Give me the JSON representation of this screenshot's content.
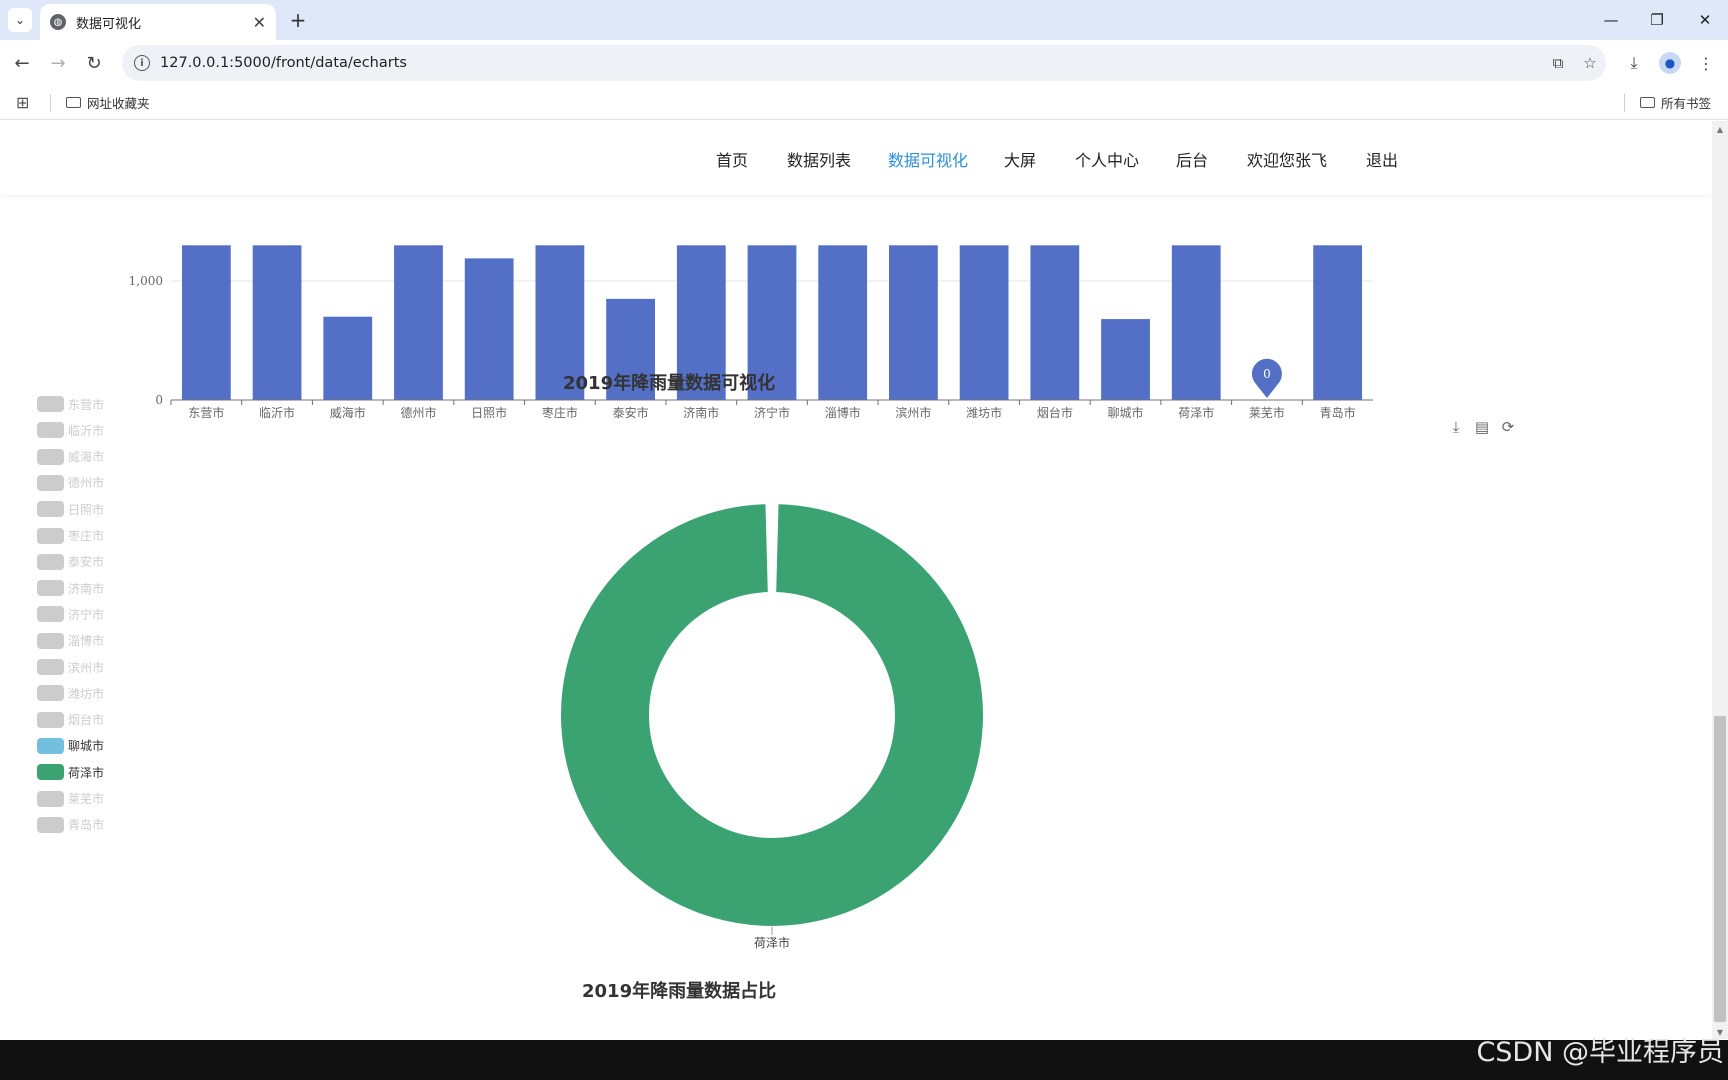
{
  "browser": {
    "tab_title": "数据可视化",
    "url": "127.0.0.1:5000/front/data/echarts",
    "bookmark_folder": "网址收藏夹",
    "all_bookmarks": "所有书签"
  },
  "site_nav": {
    "items": [
      "首页",
      "数据列表",
      "数据可视化",
      "大屏",
      "个人中心",
      "后台",
      "欢迎您张飞",
      "退出"
    ],
    "active": "数据可视化"
  },
  "colors": {
    "bar": "#5470c6",
    "pie_selected": "#3ba272",
    "legend_selected_1": "#73c0de",
    "legend_selected_2": "#3ba272",
    "legend_disabled": "#cccccc",
    "nav_active": "#2d8fd6"
  },
  "chart_data": [
    {
      "type": "bar",
      "title": "2019年降雨量数据可视化",
      "categories": [
        "东营市",
        "临沂市",
        "威海市",
        "德州市",
        "日照市",
        "枣庄市",
        "泰安市",
        "济南市",
        "济宁市",
        "淄博市",
        "滨州市",
        "潍坊市",
        "烟台市",
        "聊城市",
        "荷泽市",
        "莱芜市",
        "青岛市"
      ],
      "values": [
        1300,
        1300,
        700,
        1300,
        1190,
        1300,
        850,
        1300,
        1300,
        1300,
        1300,
        1300,
        1300,
        680,
        1300,
        0,
        1300
      ],
      "y_ticks": [
        "0",
        "1,000"
      ],
      "markpoint": {
        "category": "莱芜市",
        "label": "0"
      }
    },
    {
      "type": "pie",
      "title": "2019年降雨量数据占比",
      "legend": [
        "东营市",
        "临沂市",
        "威海市",
        "德州市",
        "日照市",
        "枣庄市",
        "泰安市",
        "济南市",
        "济宁市",
        "淄博市",
        "滨州市",
        "潍坊市",
        "烟台市",
        "聊城市",
        "荷泽市",
        "莱芜市",
        "青岛市"
      ],
      "legend_selected": [
        "聊城市",
        "荷泽市"
      ],
      "slices": [
        {
          "name": "荷泽市",
          "share": 0.999
        },
        {
          "name": "聊城市",
          "share": 0.001
        }
      ],
      "slice_label": "荷泽市"
    }
  ],
  "toolbox": [
    "download-icon",
    "data-view-icon",
    "restore-icon"
  ],
  "watermark": "CSDN @毕业程序员"
}
